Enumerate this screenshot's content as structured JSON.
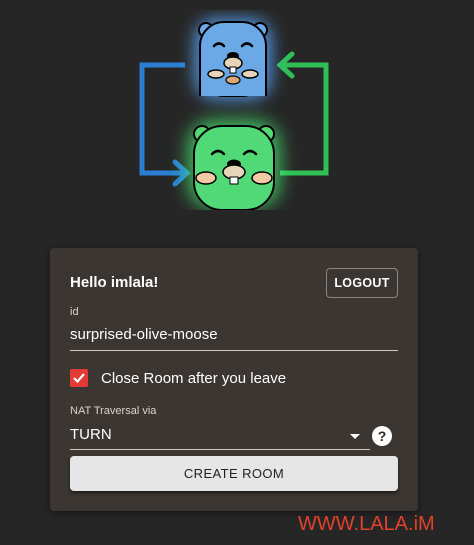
{
  "logo": {
    "icon": "gopher-swap-logo-icon"
  },
  "card": {
    "greeting": "Hello imlala!",
    "logout_label": "LOGOUT",
    "id_label": "id",
    "id_value": "surprised-olive-moose",
    "close_room_label": "Close Room after you leave",
    "close_room_checked": true,
    "nat_label": "NAT Traversal via",
    "nat_value": "TURN",
    "help_glyph": "?",
    "create_label": "CREATE ROOM"
  },
  "watermark": "WWW.LALA.iM",
  "colors": {
    "background": "#262626",
    "card": "#3b3632",
    "checkbox": "#e53935",
    "blue_gopher": "#4a90e2",
    "green_gopher": "#4cdb6e",
    "watermark": "#e2412a"
  }
}
